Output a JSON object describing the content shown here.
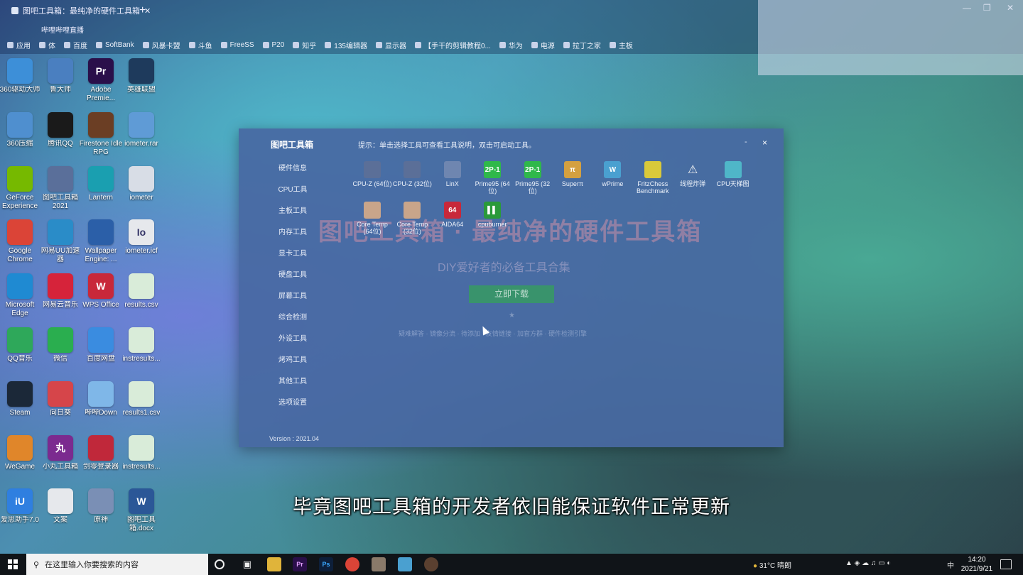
{
  "browser": {
    "tab1": "图吧工具箱：最纯净的硬件工具箱",
    "tab2": "哔哩哔哩直播",
    "tab_new": "+"
  },
  "bookmarks": [
    "应用",
    "体",
    "百度",
    "SoftBank",
    "风暴卡盟",
    "斗鱼",
    "FreeSS",
    "P20",
    "知乎",
    "135编辑器",
    "显示器",
    "【手干的剪辑教程0...",
    "华为",
    "电源",
    "拉丁之家",
    "主板"
  ],
  "desktop_icons": [
    {
      "label": "360驱动大师",
      "icon": "360-driver-icon",
      "color": "#3d8fd8"
    },
    {
      "label": "鲁大师",
      "icon": "ludashi-icon",
      "color": "#4a7fc0"
    },
    {
      "label": "Adobe Premie...",
      "icon": "premiere-icon",
      "color": "#2a0f4a",
      "glyph": "Pr"
    },
    {
      "label": "英雄联盟",
      "icon": "lol-icon",
      "color": "#1e3a5c"
    },
    {
      "label": "360压缩",
      "icon": "archive-icon",
      "color": "#4f8fcf"
    },
    {
      "label": "腾讯QQ",
      "icon": "qq-icon",
      "color": "#1a1a1a"
    },
    {
      "label": "Firestone Idle RPG",
      "icon": "firestone-icon",
      "color": "#6b3e24"
    },
    {
      "label": "iometer.rar",
      "icon": "rar-icon",
      "color": "#5f9bd6"
    },
    {
      "label": "GeForce Experience",
      "icon": "nvidia-icon",
      "color": "#76b900"
    },
    {
      "label": "图吧工具箱 2021",
      "icon": "toolbox-icon",
      "color": "#5a6f9a"
    },
    {
      "label": "Lantern",
      "icon": "lantern-icon",
      "color": "#1a9fb0"
    },
    {
      "label": "iometer",
      "icon": "file-icon",
      "color": "#d8dde6"
    },
    {
      "label": "Google Chrome",
      "icon": "chrome-icon",
      "color": "#db4437"
    },
    {
      "label": "网易UU加速器",
      "icon": "uu-icon",
      "color": "#2a8cc8"
    },
    {
      "label": "Wallpaper Engine: ...",
      "icon": "wallpaper-engine-icon",
      "color": "#2b5fa8"
    },
    {
      "label": "iometer.icf",
      "icon": "icf-icon",
      "color": "#e6e8ec",
      "glyph": "Io"
    },
    {
      "label": "Microsoft Edge",
      "icon": "edge-icon",
      "color": "#1f8ad2"
    },
    {
      "label": "网易云音乐",
      "icon": "netease-music-icon",
      "color": "#d6233a"
    },
    {
      "label": "WPS Office",
      "icon": "wps-icon",
      "color": "#c8283a",
      "glyph": "W"
    },
    {
      "label": "results.csv",
      "icon": "csv-icon",
      "color": "#d9ecd9"
    },
    {
      "label": "QQ音乐",
      "icon": "qq-music-icon",
      "color": "#2ea85a"
    },
    {
      "label": "微信",
      "icon": "wechat-icon",
      "color": "#2aae4f"
    },
    {
      "label": "百度网盘",
      "icon": "baidu-pan-icon",
      "color": "#3a8ce0"
    },
    {
      "label": "instresults...",
      "icon": "csv-icon",
      "color": "#d9ecd9"
    },
    {
      "label": "Steam",
      "icon": "steam-icon",
      "color": "#1b2838"
    },
    {
      "label": "向日葵",
      "icon": "sunflower-icon",
      "color": "#d6454a"
    },
    {
      "label": "哔哔Down",
      "icon": "bilidown-icon",
      "color": "#7fb7e8"
    },
    {
      "label": "results1.csv",
      "icon": "csv-icon",
      "color": "#d9ecd9"
    },
    {
      "label": "WeGame",
      "icon": "wegame-icon",
      "color": "#e0862a"
    },
    {
      "label": "小丸工具箱",
      "icon": "xiaowan-icon",
      "color": "#7b2a8f",
      "glyph": "丸"
    },
    {
      "label": "剑零登录器",
      "icon": "jianling-icon",
      "color": "#c0283a"
    },
    {
      "label": "instresults...",
      "icon": "csv-icon",
      "color": "#d9ecd9"
    },
    {
      "label": "爱思助手7.0",
      "icon": "i4-icon",
      "color": "#2f7fe0",
      "glyph": "iU"
    },
    {
      "label": "文案",
      "icon": "doc-icon",
      "color": "#e6e8ec"
    },
    {
      "label": "原神",
      "icon": "genshin-icon",
      "color": "#7a8fb5"
    },
    {
      "label": "图吧工具箱.docx",
      "icon": "word-icon",
      "color": "#2b5797",
      "glyph": "W"
    }
  ],
  "app": {
    "title": "图吧工具箱",
    "hint": "提示：单击选择工具可查看工具说明，双击可启动工具。",
    "minimize": "-",
    "close": "×",
    "version": "Version : 2021.04",
    "sidebar": [
      "硬件信息",
      "CPU工具",
      "主板工具",
      "内存工具",
      "显卡工具",
      "硬盘工具",
      "屏幕工具",
      "综合检测",
      "外设工具",
      "烤鸡工具",
      "其他工具",
      "选项设置"
    ],
    "tools": [
      {
        "label": "CPU-Z (64位)",
        "icon": "cpuz-icon",
        "color": "#5b6f98"
      },
      {
        "label": "CPU-Z (32位)",
        "icon": "cpuz-icon",
        "color": "#5b6f98"
      },
      {
        "label": "LinX",
        "icon": "linx-icon",
        "color": "#6f86b0"
      },
      {
        "label": "Prime95 (64位)",
        "icon": "prime95-icon",
        "color": "#2fb84a",
        "glyph": "2P-1"
      },
      {
        "label": "Prime95 (32位)",
        "icon": "prime95-icon",
        "color": "#2fb84a",
        "glyph": "2P-1"
      },
      {
        "label": "Superπ",
        "icon": "superpi-icon",
        "color": "#d4a040",
        "glyph": "π"
      },
      {
        "label": "wPrime",
        "icon": "wprime-icon",
        "color": "#4aa0d0",
        "glyph": "W"
      },
      {
        "label": "FritzChess Benchmark",
        "icon": "fritz-icon",
        "color": "#d9c93a"
      },
      {
        "label": "线程炸弹",
        "icon": "warning-icon",
        "color": "transparent",
        "glyph": "⚠"
      },
      {
        "label": "CPU天梯图",
        "icon": "doc-icon",
        "color": "#4fb6c8"
      },
      {
        "label": "Core Temp (64位)",
        "icon": "thermometer-icon",
        "color": "#c9a58a"
      },
      {
        "label": "Core Temp (32位)",
        "icon": "thermometer-icon",
        "color": "#c9a58a"
      },
      {
        "label": "AIDA64",
        "icon": "aida64-icon",
        "color": "#c8283a",
        "glyph": "64"
      },
      {
        "label": "cpuburner",
        "icon": "cpuburner-icon",
        "color": "#2a9a3a",
        "glyph": "▌▌"
      }
    ],
    "watermark_title": "图吧工具箱 · 最纯净的硬件工具箱",
    "watermark_subtitle": "DIY爱好者的必备工具合集",
    "download_button": "立即下载",
    "star": "★",
    "footer_links": "疑难解答 · 镜像分流 · 待添加 · 友情链接 · 加官方群 · 硬件检测引擎"
  },
  "subtitle": "毕竟图吧工具箱的开发者依旧能保证软件正常更新",
  "taskbar": {
    "search_placeholder": "在这里输入你要搜索的内容",
    "tray_weather": "31°C 晴朗",
    "ime": "中",
    "time": "14:20",
    "date": "2021/9/21"
  }
}
